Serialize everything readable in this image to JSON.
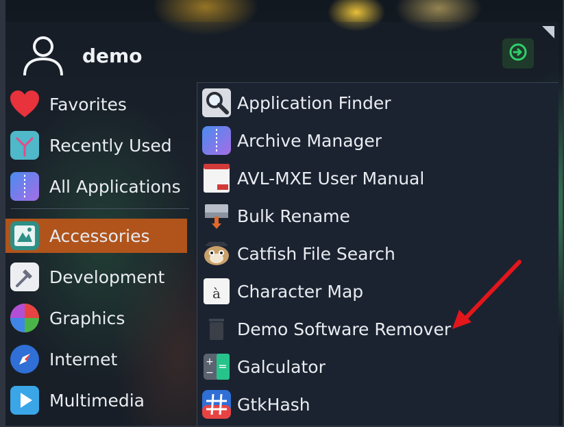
{
  "user": {
    "name": "demo",
    "avatar_icon": "user-avatar-icon"
  },
  "logout": {
    "icon": "logout-icon",
    "color": "#2fd06a"
  },
  "categories": [
    {
      "label": "Favorites",
      "icon": "heart-icon"
    },
    {
      "label": "Recently Used",
      "icon": "recent-icon"
    },
    {
      "label": "All Applications",
      "icon": "all-apps-icon"
    },
    {
      "label": "Accessories",
      "icon": "accessories-icon",
      "active": true
    },
    {
      "label": "Development",
      "icon": "hammer-icon"
    },
    {
      "label": "Graphics",
      "icon": "graphics-icon"
    },
    {
      "label": "Internet",
      "icon": "compass-icon"
    },
    {
      "label": "Multimedia",
      "icon": "play-icon"
    }
  ],
  "apps": [
    {
      "label": "Application Finder",
      "icon": "magnifier-icon"
    },
    {
      "label": "Archive Manager",
      "icon": "archive-icon"
    },
    {
      "label": "AVL-MXE User Manual",
      "icon": "pdf-icon"
    },
    {
      "label": "Bulk Rename",
      "icon": "bulk-rename-icon"
    },
    {
      "label": "Catfish File Search",
      "icon": "catfish-icon"
    },
    {
      "label": "Character Map",
      "icon": "character-map-icon"
    },
    {
      "label": "Demo Software Remover",
      "icon": "trash-icon"
    },
    {
      "label": "Galculator",
      "icon": "calculator-icon"
    },
    {
      "label": "GtkHash",
      "icon": "hash-icon"
    }
  ],
  "colors": {
    "accent": "#b0541c",
    "panel": "#1b2331",
    "arrow": "#e3161b"
  }
}
